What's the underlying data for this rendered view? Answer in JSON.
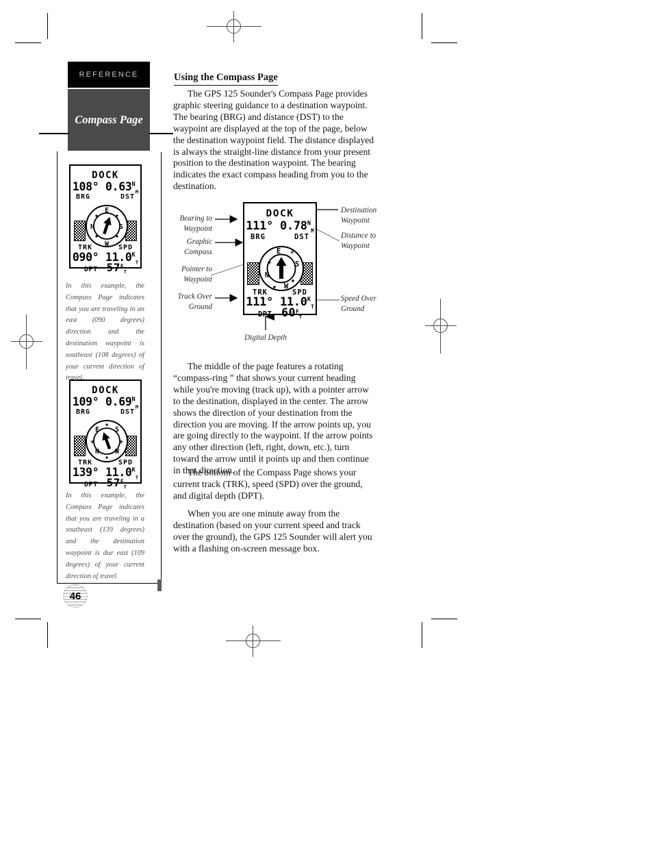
{
  "document": {
    "page_number": "46",
    "tab_top_label": "REFERENCE",
    "tab_section_label": "Compass Page"
  },
  "main": {
    "heading": "Using the Compass Page",
    "paragraphs": [
      "The GPS 125 Sounder's Compass Page provides graphic steering guidance to a destination waypoint. The bearing (BRG) and distance (DST) to the waypoint are displayed at the top of the page, below the destination waypoint field. The distance displayed is always the straight-line distance from your present position to the destination waypoint. The bearing indicates the exact compass heading from you to the destination.",
      "The middle of the page features a rotating “compass-ring ” that shows your current heading while you're moving (track up), with a pointer arrow to the destination, displayed in the center. The arrow shows the direction of your destination from the direction you are moving. If the arrow points up, you are going directly to the waypoint. If the arrow points any other direction (left, right, down, etc.), turn toward the arrow until it points up and then continue in that direction.",
      "The bottom of the Compass Page shows your current track (TRK), speed (SPD) over the ground, and digital depth (DPT).",
      "When you are one minute away from the destination (based on your current speed and track over the ground), the GPS 125 Sounder will alert you with a flashing on-screen message box."
    ]
  },
  "figure": {
    "annotations": {
      "bearing_to_waypoint": "Bearing to\nWaypoint",
      "graphic_compass": "Graphic\nCompass",
      "pointer_to_waypoint": "Pointer to\nWaypoint",
      "track_over_ground": "Track Over\nGround",
      "destination_waypoint": "Destination\nWaypoint",
      "distance_to_waypoint": "Distance to\nWaypoint",
      "speed_over_ground": "Speed Over\nGround",
      "digital_depth": "Digital Depth"
    },
    "screen": {
      "waypoint": "DOCK",
      "bearing": "111°",
      "distance": "0.78",
      "distance_unit": "N",
      "distance_unit_sub": "M",
      "label_brg": "BRG",
      "label_dst": "DST",
      "label_trk": "TRK",
      "label_spd": "SPD",
      "track": "111°",
      "speed": "11.0",
      "speed_unit": "K",
      "speed_unit_sub": "T",
      "label_dpt": "DPT",
      "depth": "60",
      "depth_unit": "F",
      "depth_unit_sub": "T",
      "compass_rose": [
        "E",
        "S",
        "W",
        "N"
      ],
      "heading_arrow_deg": 0,
      "pointer_arrow_deg": 225
    }
  },
  "sidebar": {
    "example_1": {
      "caption": "In this example, the Compass Page indicates that you are traveling in an east (090 degrees) direction and the destination waypoint is southeast (108 degrees) of your current direction of travel.",
      "screen": {
        "waypoint": "DOCK",
        "bearing": "108°",
        "distance": "0.63",
        "distance_unit": "N",
        "distance_unit_sub": "M",
        "label_brg": "BRG",
        "label_dst": "DST",
        "label_trk": "TRK",
        "label_spd": "SPD",
        "track": "090°",
        "speed": "11.0",
        "speed_unit": "K",
        "speed_unit_sub": "T",
        "label_dpt": "DPT",
        "depth": "57",
        "depth_unit": "F",
        "depth_unit_sub": "T",
        "compass_rose": [
          "E",
          "S",
          "W",
          "N"
        ],
        "heading_arrow_deg": 0,
        "pointer_arrow_deg": 18
      }
    },
    "example_2": {
      "caption": "In this example, the Compass Page indicates that you are traveling in a southeast (139 degrees) and the destination waypoint is due east (109 degrees) of your current direction of travel.",
      "screen": {
        "waypoint": "DOCK",
        "bearing": "109°",
        "distance": "0.69",
        "distance_unit": "N",
        "distance_unit_sub": "M",
        "label_brg": "BRG",
        "label_dst": "DST",
        "label_trk": "TRK",
        "label_spd": "SPD",
        "track": "139°",
        "speed": "11.0",
        "speed_unit": "K",
        "speed_unit_sub": "T",
        "label_dpt": "DPT",
        "depth": "57",
        "depth_unit": "F",
        "depth_unit_sub": "T",
        "compass_rose": [
          "E",
          "S",
          "W",
          "N"
        ],
        "heading_arrow_deg": 0,
        "pointer_arrow_deg": 340
      }
    }
  },
  "colors": {
    "tab_top_bg": "#000000",
    "tab_section_bg": "#4a4a48",
    "caption_text": "#4d4d4d",
    "body_text": "#141414"
  }
}
